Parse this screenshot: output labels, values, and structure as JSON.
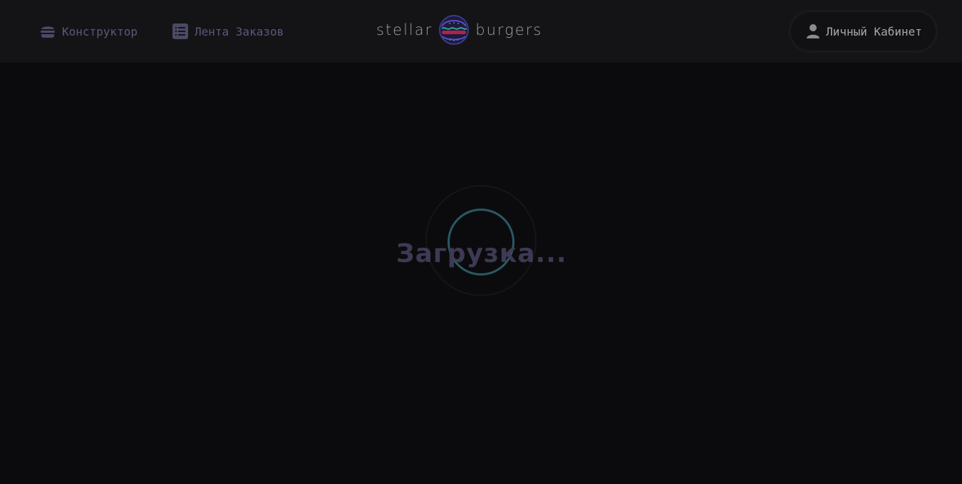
{
  "header": {
    "nav": {
      "constructor_label": "Конструктор",
      "feed_label": "Лента Заказов"
    },
    "logo": {
      "left_word": "stellar",
      "right_word": "burgers"
    },
    "profile_label": "Личный Кабинет"
  },
  "main": {
    "loading_text": "Загрузка..."
  },
  "colors": {
    "background": "#0b0b0d",
    "header_bg": "#141417",
    "nav_text": "#59597a",
    "spinner": "#2a5a62",
    "loading_text": "#3d3a55"
  },
  "icons": {
    "constructor": "burger-icon",
    "feed": "list-icon",
    "profile": "user-icon"
  }
}
